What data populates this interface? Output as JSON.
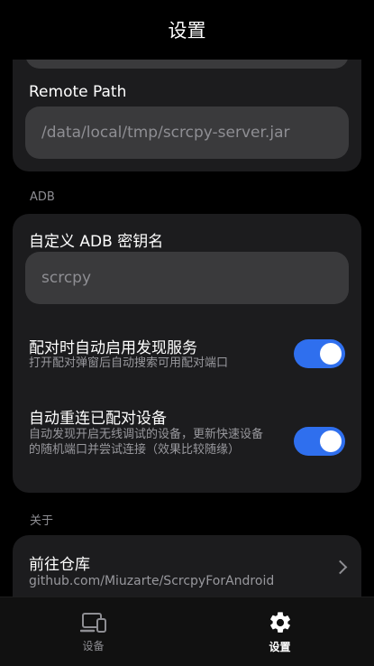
{
  "header": {
    "title": "设置"
  },
  "server": {
    "remote_path_label": "Remote Path",
    "remote_path_value": "/data/local/tmp/scrcpy-server.jar"
  },
  "adb": {
    "section_title": "ADB",
    "key_name_label": "自定义 ADB 密钥名",
    "key_name_value": "scrcpy",
    "auto_discover": {
      "title": "配对时自动启用发现服务",
      "desc": "打开配对弹窗后自动搜索可用配对端口",
      "enabled": true
    },
    "auto_reconnect": {
      "title": "自动重连已配对设备",
      "desc": "自动发现开启无线调试的设备，更新快速设备的随机端口并尝试连接（效果比较随缘）",
      "enabled": true
    }
  },
  "about": {
    "section_title": "关于",
    "repo_title": "前往仓库",
    "repo_url": "github.com/Miuzarte/ScrcpyForAndroid"
  },
  "nav": {
    "devices_label": "设备",
    "settings_label": "设置",
    "active": "settings",
    "inactive_color": "#8e8e93",
    "active_color": "#ffffff"
  },
  "colors": {
    "background": "#000000",
    "card": "#1c1c1e",
    "input": "#3a3a3c",
    "accent": "#2f6fee"
  },
  "icons": {
    "devices": "devices-icon",
    "settings": "gear-icon",
    "chevron": "chevron-right-icon"
  }
}
